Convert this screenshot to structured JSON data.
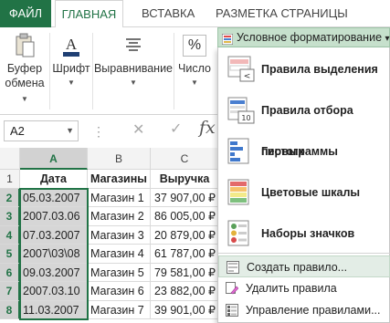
{
  "ribbon": {
    "tabs": {
      "file": "ФАЙЛ",
      "home": "ГЛАВНАЯ",
      "insert": "ВСТАВКА",
      "page_layout": "РАЗМЕТКА СТРАНИЦЫ"
    },
    "groups": {
      "clipboard": {
        "line1": "Буфер",
        "line2": "обмена",
        "icon": "clipboard-icon"
      },
      "font": {
        "label": "Шрифт",
        "icon": "font-color-icon"
      },
      "alignment": {
        "label": "Выравнивание",
        "icon": "align-icon"
      },
      "number": {
        "label": "Число",
        "icon": "percent-icon",
        "symbol": "%"
      }
    },
    "conditional_formatting": {
      "label": "Условное форматирование",
      "arrow": "▾"
    }
  },
  "formula_bar": {
    "name_box": "A2",
    "cancel_symbol": "✕",
    "enter_symbol": "✓",
    "fx_label": "fx"
  },
  "sheet": {
    "columns": [
      "A",
      "B",
      "C"
    ],
    "rows": [
      "1",
      "2",
      "3",
      "4",
      "5",
      "6",
      "7",
      "8"
    ],
    "header": [
      "Дата",
      "Магазины",
      "Выручка"
    ],
    "data": [
      [
        "05.03.2007",
        "Магазин 1",
        "37 907,00 ₽"
      ],
      [
        "2007.03.06",
        "Магазин 2",
        "86 005,00 ₽"
      ],
      [
        "07.03.2007",
        "Магазин 3",
        "20 879,00 ₽"
      ],
      [
        "2007\\03\\08",
        "Магазин 4",
        "61 787,00 ₽"
      ],
      [
        "09.03.2007",
        "Магазин 5",
        "79 581,00 ₽"
      ],
      [
        "2007.03.10",
        "Магазин 6",
        "23 882,00 ₽"
      ],
      [
        "11.03.2007",
        "Магазин 7",
        "39 901,00 ₽"
      ]
    ]
  },
  "menu": {
    "items": [
      {
        "label": "Правила выделения",
        "icon": "highlight-rules-icon"
      },
      {
        "label": "Правила отбора первых",
        "icon": "top-bottom-rules-icon",
        "badge": "10"
      },
      {
        "label": "Гистограммы",
        "icon": "data-bars-icon"
      },
      {
        "label": "Цветовые шкалы",
        "icon": "color-scales-icon"
      },
      {
        "label": "Наборы значков",
        "icon": "icon-sets-icon"
      }
    ],
    "small_items": [
      {
        "label": "Создать правило...",
        "icon": "new-rule-icon"
      },
      {
        "label": "Удалить правила",
        "icon": "clear-rules-icon"
      },
      {
        "label": "Управление правилами...",
        "icon": "manage-rules-icon"
      }
    ]
  },
  "colors": {
    "accent": "#217346",
    "highlight": "#c6e0cc",
    "selection": "#d6d6d6"
  }
}
